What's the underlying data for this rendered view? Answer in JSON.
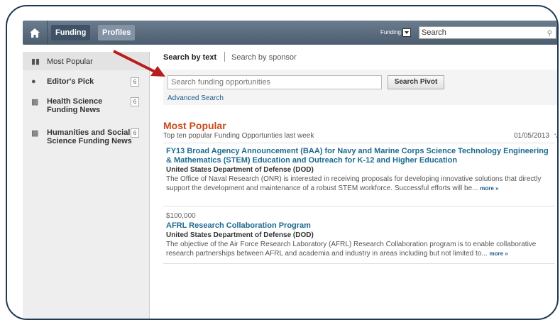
{
  "nav": {
    "tabs": [
      {
        "label": "Funding"
      },
      {
        "label": "Profiles"
      }
    ],
    "scope_label": "Funding",
    "search_value": "Search"
  },
  "sidebar": {
    "items": [
      {
        "label": "Most Popular",
        "count": ""
      },
      {
        "label": "Editor's Pick",
        "count": "6"
      },
      {
        "label": "Health Science Funding News",
        "count": "6"
      },
      {
        "label": "Humanities and Social Science Funding News",
        "count": "6"
      }
    ]
  },
  "search": {
    "tab_text": "Search by text",
    "tab_sponsor": "Search by sponsor",
    "placeholder": "Search funding opportunities",
    "button": "Search Pivot",
    "advanced": "Advanced Search"
  },
  "popular": {
    "title": "Most Popular",
    "subtitle": "Top ten popular Funding Opportunties last week",
    "date": "01/05/2013",
    "results": [
      {
        "amount": "",
        "title": "FY13 Broad Agency Announcement (BAA) for Navy and Marine Corps Science Technology Engineering & Mathematics (STEM) Education and Outreach for K-12 and Higher Education",
        "agency": "United States Department of Defense (DOD)",
        "desc": "The Office of Naval Research (ONR) is interested in receiving proposals for developing innovative solutions that directly support the development and maintenance of a robust STEM workforce. Successful efforts will be...",
        "more": "more »"
      },
      {
        "amount": "$100,000",
        "title": "AFRL Research Collaboration Program",
        "agency": "United States Department of Defense (DOD)",
        "desc": "The objective of the Air Force Research Laboratory (AFRL) Research Collaboration program is to enable collaborative research partnerships between AFRL and academia and industry in areas including but not limited to...",
        "more": "more »"
      }
    ]
  },
  "colors": {
    "accent": "#cc4a1a",
    "link": "#1c6a8e",
    "nav": "#4c5d70",
    "arrow": "#b81d1d"
  }
}
